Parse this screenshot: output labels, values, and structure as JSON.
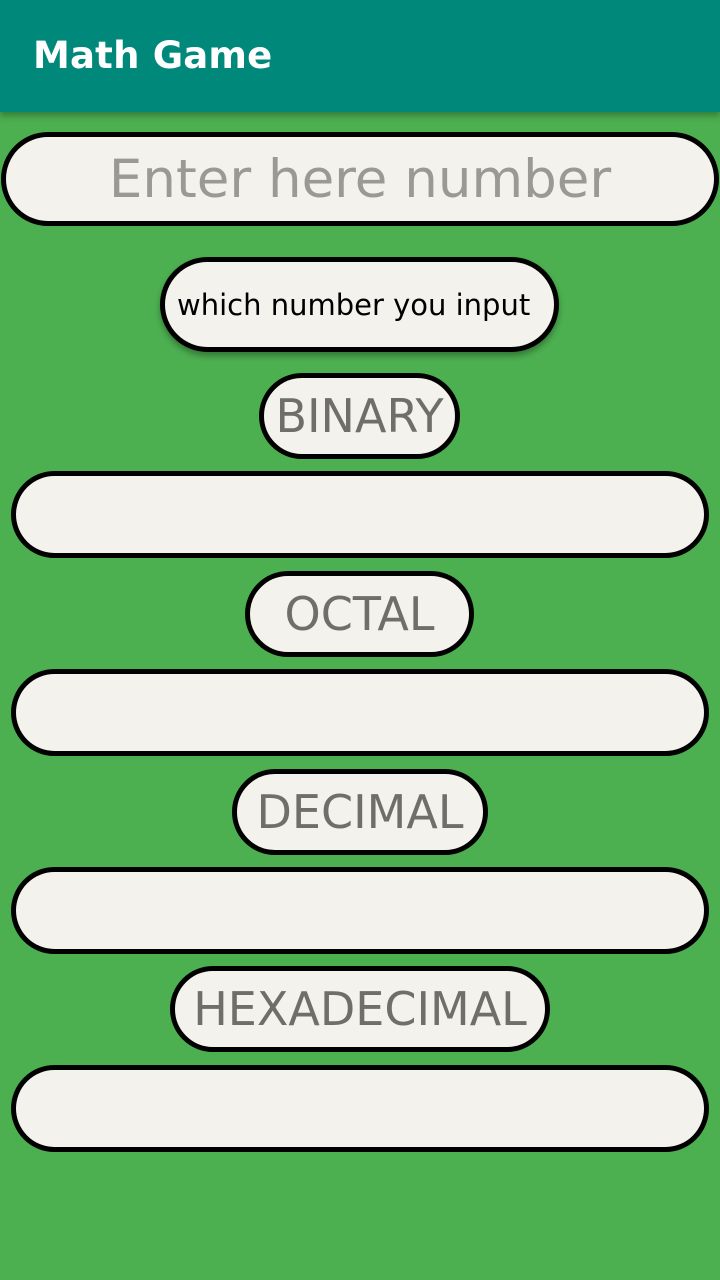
{
  "appbar": {
    "title": "Math Game",
    "color": "#00897B"
  },
  "background_color": "#4CAF50",
  "input": {
    "placeholder": "Enter here number",
    "value": ""
  },
  "hint": {
    "label": "which number you input"
  },
  "conversions": [
    {
      "label": "BINARY",
      "value": ""
    },
    {
      "label": "OCTAL",
      "value": ""
    },
    {
      "label": "DECIMAL",
      "value": ""
    },
    {
      "label": "HEXADECIMAL",
      "value": ""
    }
  ]
}
